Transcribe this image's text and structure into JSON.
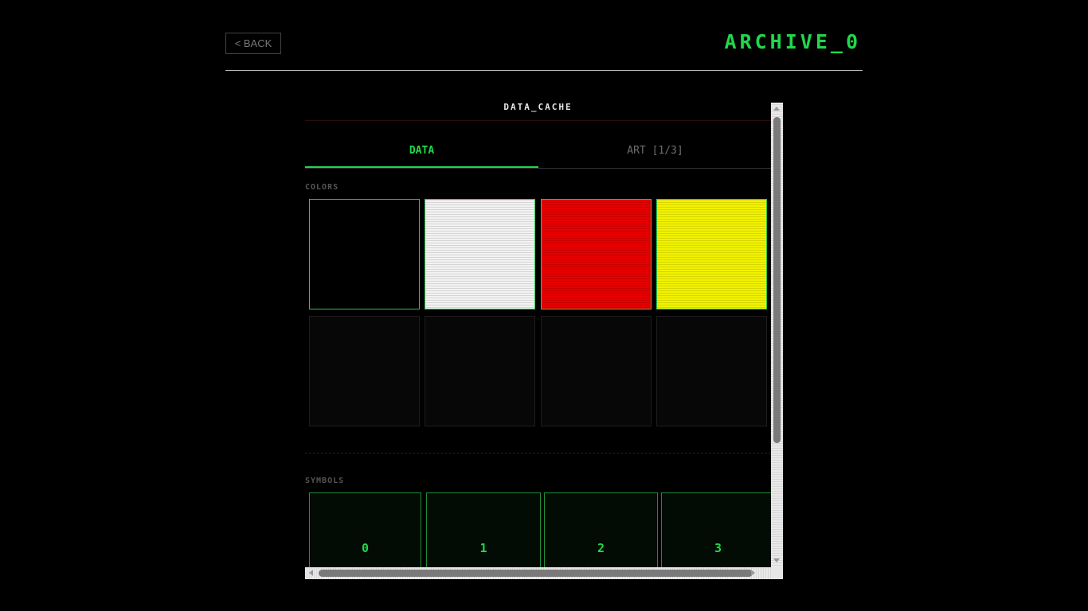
{
  "header": {
    "back_label": "< BACK",
    "title": "ARCHIVE_0"
  },
  "panel": {
    "title": "DATA_CACHE",
    "tabs": [
      {
        "label": "DATA",
        "active": true
      },
      {
        "label": "ART [1/3]",
        "active": false
      }
    ],
    "colors_label": "COLORS",
    "colors": [
      {
        "hex": "#000000"
      },
      {
        "hex": "#f2f2f2"
      },
      {
        "hex": "#e60000"
      },
      {
        "hex": "#f2f200"
      },
      {
        "hex": null
      },
      {
        "hex": null
      },
      {
        "hex": null
      },
      {
        "hex": null
      }
    ],
    "symbols_label": "SYMBOLS",
    "symbols": [
      "0",
      "1",
      "2",
      "3"
    ]
  },
  "theme": {
    "accent": "#20d84a",
    "background": "#000000"
  }
}
